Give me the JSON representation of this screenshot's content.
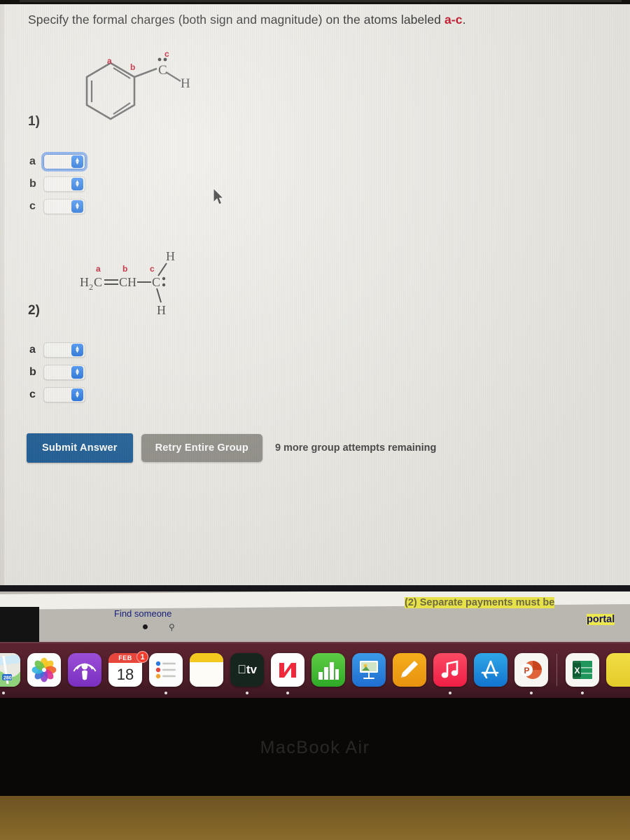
{
  "prompt": {
    "text_before": "Specify the formal charges (both sign and magnitude) on the atoms labeled ",
    "labels": "a-c",
    "text_after": "."
  },
  "questions": [
    {
      "number": "1)",
      "molecule": {
        "name": "phenyl-carbanion",
        "description": "benzene ring attached to a carbon bearing one hydrogen and a lone pair",
        "atom_labels": [
          "a",
          "b",
          "c"
        ],
        "atom_label_color": "#c00018",
        "atom_text": [
          "C",
          "H"
        ]
      },
      "fields": [
        {
          "label": "a",
          "value": "",
          "focused": true
        },
        {
          "label": "b",
          "value": "",
          "focused": false
        },
        {
          "label": "c",
          "value": "",
          "focused": false
        }
      ]
    },
    {
      "number": "2)",
      "molecule": {
        "name": "allyl-carbanion",
        "description": "H2C=CH-C with two hydrogens and a lone pair",
        "atom_labels": [
          "a",
          "b",
          "c"
        ],
        "atom_label_color": "#c00018",
        "formula_left": "H",
        "formula_sub": "2",
        "formula_mid": "C",
        "formula_eq": "CH",
        "formula_right": "C",
        "h_top": "H",
        "h_bottom": "H"
      },
      "fields": [
        {
          "label": "a",
          "value": "",
          "focused": false
        },
        {
          "label": "b",
          "value": "",
          "focused": false
        },
        {
          "label": "c",
          "value": "",
          "focused": false
        }
      ]
    }
  ],
  "toolbar": {
    "submit_label": "Submit Answer",
    "retry_label": "Retry Entire Group",
    "attempts_text": "9 more group attempts remaining",
    "submit_color": "#10538f",
    "retry_color": "#8a8880"
  },
  "background_window": {
    "find_someone": "Find someone",
    "highlight_line_1": "(2) Separate payments must be",
    "highlight_line_2": "portal",
    "highlight_color": "#e8e24a"
  },
  "dock": {
    "items": [
      {
        "name": "maps",
        "label": "",
        "running": true,
        "badge": ""
      },
      {
        "name": "photos",
        "label": "",
        "running": false,
        "badge": ""
      },
      {
        "name": "podcasts",
        "label": "",
        "running": false,
        "badge": ""
      },
      {
        "name": "calendar",
        "label": "FEB",
        "day": "18",
        "running": false,
        "badge": "1"
      },
      {
        "name": "reminders",
        "label": "",
        "running": true,
        "badge": ""
      },
      {
        "name": "notes",
        "label": "",
        "running": false,
        "badge": ""
      },
      {
        "name": "apple-tv",
        "label": "tv",
        "running": true,
        "badge": ""
      },
      {
        "name": "news",
        "label": "",
        "running": true,
        "badge": ""
      },
      {
        "name": "numbers",
        "label": "",
        "running": false,
        "badge": ""
      },
      {
        "name": "keynote",
        "label": "",
        "running": false,
        "badge": ""
      },
      {
        "name": "pages",
        "label": "",
        "running": false,
        "badge": ""
      },
      {
        "name": "music",
        "label": "",
        "running": true,
        "badge": ""
      },
      {
        "name": "app-store",
        "label": "",
        "running": false,
        "badge": ""
      },
      {
        "name": "powerpoint",
        "label": "P",
        "running": true,
        "badge": ""
      },
      {
        "name": "excel",
        "label": "X",
        "running": true,
        "badge": ""
      }
    ]
  },
  "device": {
    "brand_text": "MacBook Air"
  }
}
